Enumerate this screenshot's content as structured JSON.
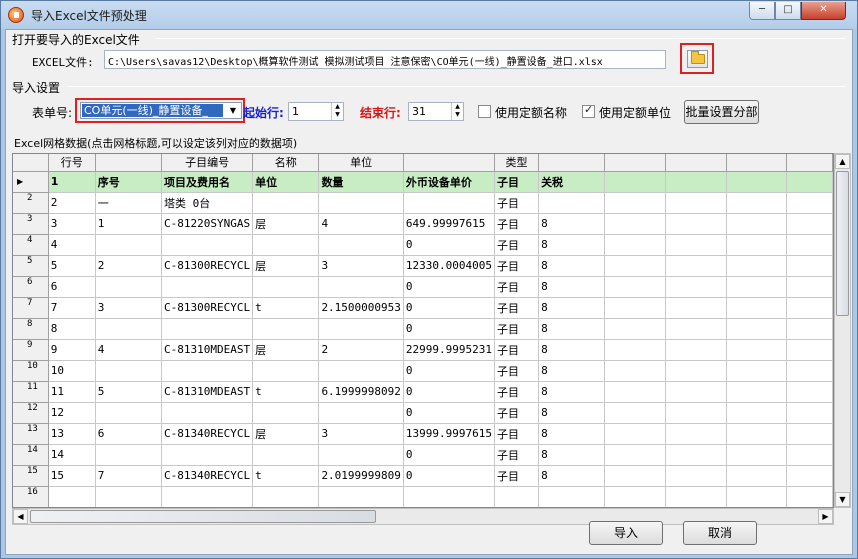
{
  "window": {
    "title": "导入Excel文件预处理",
    "controls": {
      "minimize": "─",
      "maximize": "□",
      "close": "✕"
    }
  },
  "open_section": {
    "title": "打开要导入的Excel文件",
    "file_label": "EXCEL文件:",
    "file_path": "C:\\Users\\savas12\\Desktop\\概算软件测试 模拟测试项目 注意保密\\CO单元(一线)_静置设备_进口.xlsx"
  },
  "import_settings": {
    "title": "导入设置",
    "sheet_label": "表单号:",
    "sheet_value": "CO单元(一线)_静置设备_",
    "start_row_label": "起始行:",
    "start_row_value": "1",
    "end_row_label": "结束行:",
    "end_row_value": "31",
    "use_quota_name_label": "使用定额名称",
    "use_quota_name_checked": false,
    "use_quota_unit_label": "使用定额单位",
    "use_quota_unit_checked": true,
    "batch_button": "批量设置分部"
  },
  "grid": {
    "title": "Excel网格数据(点击网格标题,可以设定该列对应的数据项)",
    "headers": [
      "",
      "行号",
      "",
      "子目编号",
      "名称",
      "单位",
      "",
      "类型",
      "",
      "",
      "",
      "",
      ""
    ],
    "rows": [
      [
        "",
        "1",
        "序号",
        "项目及费用名",
        "单位",
        "数量",
        "外币设备单价",
        "子目",
        "关税",
        "",
        "",
        "",
        ""
      ],
      [
        "2",
        "2",
        "一",
        "塔类       0台",
        "",
        "",
        "",
        "子目",
        "",
        "",
        "",
        "",
        ""
      ],
      [
        "3",
        "3",
        "1",
        "C-81220SYNGAS",
        "层",
        "4",
        "649.99997615",
        "子目",
        "8",
        "",
        "",
        "",
        ""
      ],
      [
        "4",
        "4",
        "",
        "",
        "",
        "",
        "0",
        "子目",
        "8",
        "",
        "",
        "",
        ""
      ],
      [
        "5",
        "5",
        "2",
        "C-81300RECYCL",
        "层",
        "3",
        "12330.0004005",
        "子目",
        "8",
        "",
        "",
        "",
        ""
      ],
      [
        "6",
        "6",
        "",
        "",
        "",
        "",
        "0",
        "子目",
        "8",
        "",
        "",
        "",
        ""
      ],
      [
        "7",
        "7",
        "3",
        "C-81300RECYCL",
        "t",
        "2.1500000953",
        "0",
        "子目",
        "8",
        "",
        "",
        "",
        ""
      ],
      [
        "8",
        "8",
        "",
        "",
        "",
        "",
        "0",
        "子目",
        "8",
        "",
        "",
        "",
        ""
      ],
      [
        "9",
        "9",
        "4",
        "C-81310MDEAST",
        "层",
        "2",
        "22999.9995231",
        "子目",
        "8",
        "",
        "",
        "",
        ""
      ],
      [
        "10",
        "10",
        "",
        "",
        "",
        "",
        "0",
        "子目",
        "8",
        "",
        "",
        "",
        ""
      ],
      [
        "11",
        "11",
        "5",
        "C-81310MDEAST",
        "t",
        "6.1999998092",
        "0",
        "子目",
        "8",
        "",
        "",
        "",
        ""
      ],
      [
        "12",
        "12",
        "",
        "",
        "",
        "",
        "0",
        "子目",
        "8",
        "",
        "",
        "",
        ""
      ],
      [
        "13",
        "13",
        "6",
        "C-81340RECYCL",
        "层",
        "3",
        "13999.9997615",
        "子目",
        "8",
        "",
        "",
        "",
        ""
      ],
      [
        "14",
        "14",
        "",
        "",
        "",
        "",
        "0",
        "子目",
        "8",
        "",
        "",
        "",
        ""
      ],
      [
        "15",
        "15",
        "7",
        "C-81340RECYCL",
        "t",
        "2.0199999809",
        "0",
        "子目",
        "8",
        "",
        "",
        "",
        ""
      ],
      [
        "16",
        "",
        "",
        "",
        "",
        "",
        "",
        "",
        "",
        "",
        "",
        "",
        ""
      ]
    ]
  },
  "buttons": {
    "import": "导入",
    "cancel": "取消"
  }
}
